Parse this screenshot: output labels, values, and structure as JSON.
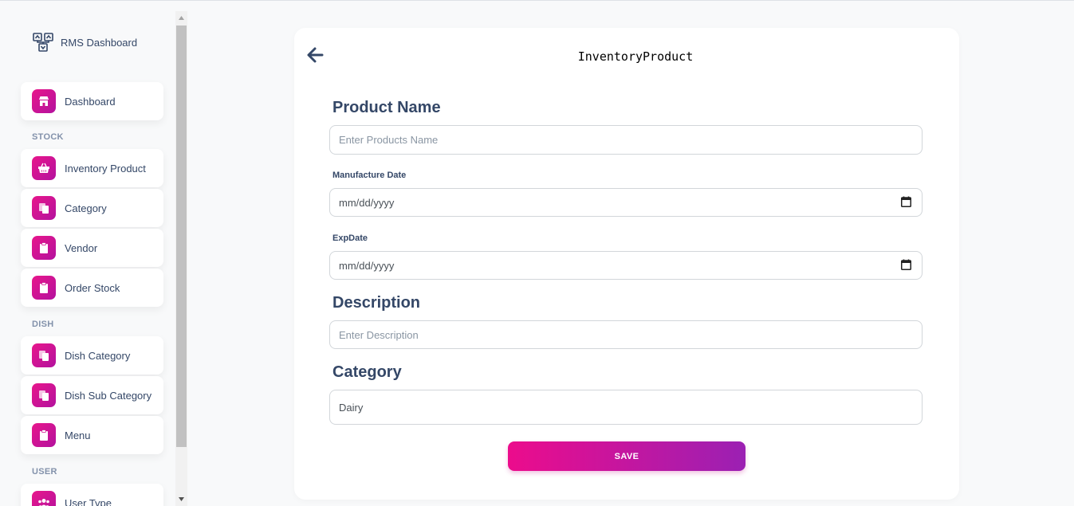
{
  "brand": {
    "label": "RMS Dashboard",
    "icon": "sitemap-icon"
  },
  "sidebar": {
    "dashboard": {
      "label": "Dashboard",
      "icon": "shop-icon"
    },
    "sections": [
      {
        "title": "STOCK",
        "items": [
          {
            "label": "Inventory Product",
            "icon": "basket-icon"
          },
          {
            "label": "Category",
            "icon": "copy-icon"
          },
          {
            "label": "Vendor",
            "icon": "clipboard-icon"
          },
          {
            "label": "Order Stock",
            "icon": "clipboard-icon"
          }
        ]
      },
      {
        "title": "DISH",
        "items": [
          {
            "label": "Dish Category",
            "icon": "copy-icon"
          },
          {
            "label": "Dish Sub Category",
            "icon": "copy-icon"
          },
          {
            "label": "Menu",
            "icon": "clipboard-icon"
          }
        ]
      },
      {
        "title": "USER",
        "items": [
          {
            "label": "User Type",
            "icon": "users-icon"
          }
        ]
      }
    ]
  },
  "form": {
    "title": "InventoryProduct",
    "product_name": {
      "label": "Product Name",
      "placeholder": "Enter Products Name"
    },
    "manufacture_date": {
      "label": "Manufacture Date",
      "value": "mm/dd/yyyy"
    },
    "exp_date": {
      "label": "ExpDate",
      "value": "mm/dd/yyyy"
    },
    "description": {
      "label": "Description",
      "placeholder": "Enter Description"
    },
    "category": {
      "label": "Category",
      "value": "Dairy"
    },
    "save_label": "SAVE"
  },
  "colors": {
    "accent_start": "#ec0c8c",
    "accent_end": "#9b20b3",
    "text": "#344767"
  }
}
